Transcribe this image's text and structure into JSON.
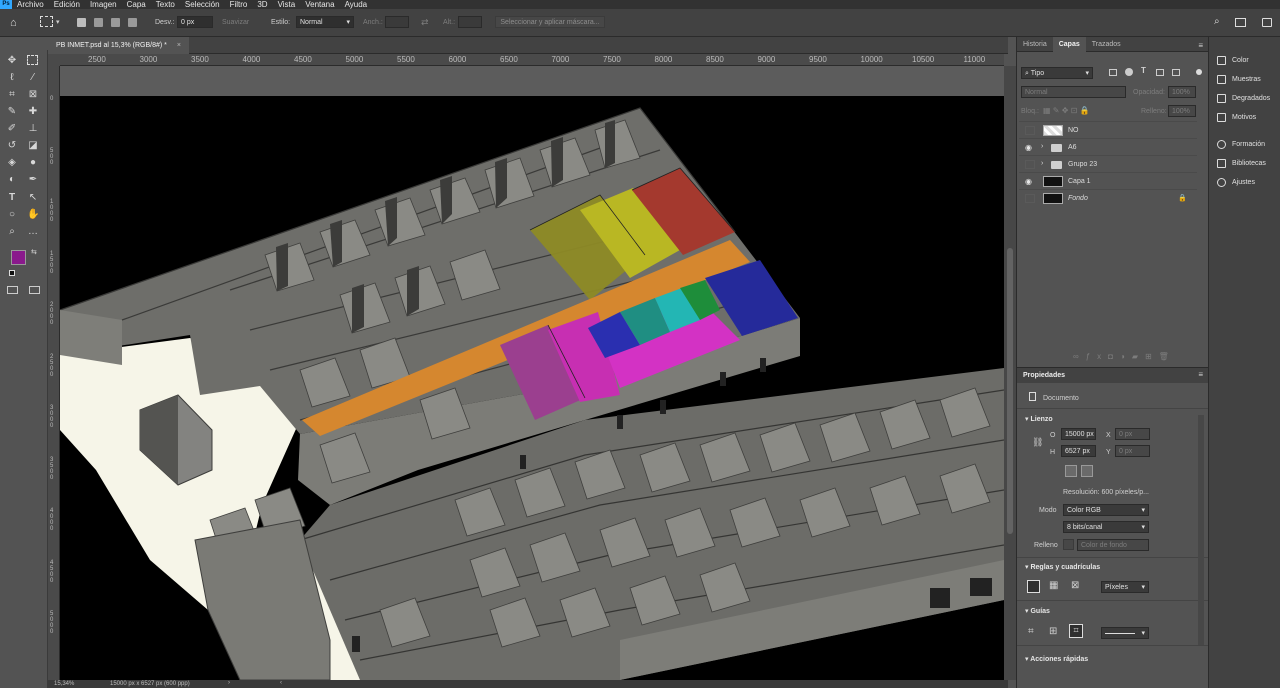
{
  "menubar": {
    "items": [
      "Archivo",
      "Edición",
      "Imagen",
      "Capa",
      "Texto",
      "Selección",
      "Filtro",
      "3D",
      "Vista",
      "Ventana",
      "Ayuda"
    ],
    "logo": "Ps"
  },
  "options": {
    "feather_label": "Desv.:",
    "feather_value": "0 px",
    "smooth_label": "Suavizar",
    "style_label": "Estilo:",
    "style_value": "Normal",
    "width_label": "Anch.:",
    "height_label": "Alt.:",
    "select_mask_label": "Seleccionar y aplicar máscara..."
  },
  "document": {
    "tab_title": "PB INMET.psd al 15,3% (RGB/8#) *"
  },
  "rulers": {
    "h_ticks": [
      "2500",
      "3000",
      "3500",
      "4000",
      "4500",
      "5000",
      "5500",
      "6000",
      "6500",
      "7000",
      "7500",
      "8000",
      "8500",
      "9000",
      "9500",
      "10000",
      "10500",
      "11000"
    ],
    "v_ticks": [
      "0",
      "5 0 0",
      "1 0 0 0",
      "1 5 0 0",
      "2 0 0 0",
      "2 5 0 0",
      "3 0 0 0",
      "3 5 0 0",
      "4 0 0 0",
      "4 5 0 0",
      "5 0 0 0"
    ]
  },
  "status": {
    "zoom": "15,34%",
    "doc_info": "15000 px x 6527 px (600 ppp)"
  },
  "panels": {
    "tabs": [
      "Historia",
      "Capas",
      "Trazados"
    ],
    "active_tab": "Capas",
    "filter_label": "Tipo",
    "blend_mode": "Normal",
    "opacity_label": "Opacidad:",
    "opacity_value": "100%",
    "lock_label": "Bloq.:",
    "fill_label": "Relleno:",
    "fill_value": "100%",
    "layers": [
      {
        "name": "NO",
        "visible": false,
        "kind": "layer"
      },
      {
        "name": "A6",
        "visible": true,
        "kind": "group"
      },
      {
        "name": "Grupo 23",
        "visible": false,
        "kind": "group"
      },
      {
        "name": "Capa 1",
        "visible": true,
        "kind": "layer"
      },
      {
        "name": "Fondo",
        "visible": false,
        "kind": "background"
      }
    ]
  },
  "properties": {
    "title": "Propiedades",
    "doc_label": "Documento",
    "canvas_section": "Lienzo",
    "w_label": "O",
    "w_value": "15000 px",
    "h_label": "H",
    "h_value": "6527 px",
    "x_label": "X",
    "x_placeholder": "0 px",
    "y_label": "Y",
    "y_placeholder": "0 px",
    "resolution": "Resolución: 600 píxeles/p...",
    "mode_label": "Modo",
    "mode_value": "Color RGB",
    "bits_value": "8 bits/canal",
    "fill_label": "Relleno",
    "fill_value": "Color de fondo",
    "rulers_section": "Reglas y cuadrículas",
    "units_value": "Píxeles",
    "guides_section": "Guías",
    "quick_actions": "Acciones rápidas"
  },
  "dock": {
    "items": [
      "Color",
      "Muestras",
      "Degradados",
      "Motivos",
      "Formación",
      "Bibliotecas",
      "Ajustes"
    ]
  },
  "colors": {
    "foreground": "#8a1a8c",
    "background": "#ffffff"
  }
}
